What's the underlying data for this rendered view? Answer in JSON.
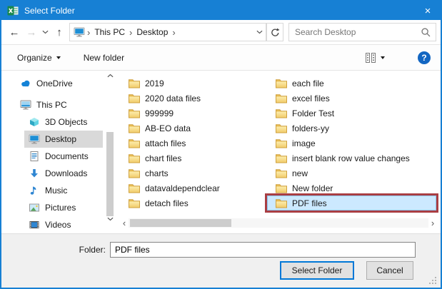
{
  "window": {
    "title": "Select Folder"
  },
  "icons": {
    "back": "←",
    "forward": "→",
    "up": "↑",
    "close": "×",
    "breadcrumb_sep": "›",
    "scroll_left": "‹",
    "scroll_right": "›",
    "help": "?"
  },
  "navbar": {
    "breadcrumb": {
      "items": [
        "This PC",
        "Desktop"
      ]
    },
    "search_placeholder": "Search Desktop"
  },
  "toolbar": {
    "organize_label": "Organize",
    "new_folder_label": "New folder"
  },
  "sidebar": {
    "items": [
      {
        "label": "OneDrive"
      },
      {
        "label": "This PC"
      },
      {
        "label": "3D Objects"
      },
      {
        "label": "Desktop",
        "selected": true
      },
      {
        "label": "Documents"
      },
      {
        "label": "Downloads"
      },
      {
        "label": "Music"
      },
      {
        "label": "Pictures"
      },
      {
        "label": "Videos"
      }
    ]
  },
  "filelist": {
    "column1": [
      "2019",
      "2020 data files",
      "999999",
      "AB-EO data",
      "attach files",
      "chart files",
      "charts",
      "datavaldependclear",
      "detach files"
    ],
    "column2": [
      "each file",
      "excel files",
      "Folder Test",
      "folders-yy",
      "image",
      "insert blank row value changes",
      "new",
      "New folder",
      "PDF files"
    ],
    "selected_item": "PDF files"
  },
  "footer": {
    "folder_label": "Folder:",
    "folder_value": "PDF files",
    "select_button": "Select Folder",
    "cancel_button": "Cancel"
  },
  "colors": {
    "accent_blue": "#1780d4",
    "selection_fill": "#cce9ff",
    "annotation_red": "#a93e43",
    "folder_yellow": "#f5d87d",
    "sidebar_selected": "#d9d9d9"
  }
}
